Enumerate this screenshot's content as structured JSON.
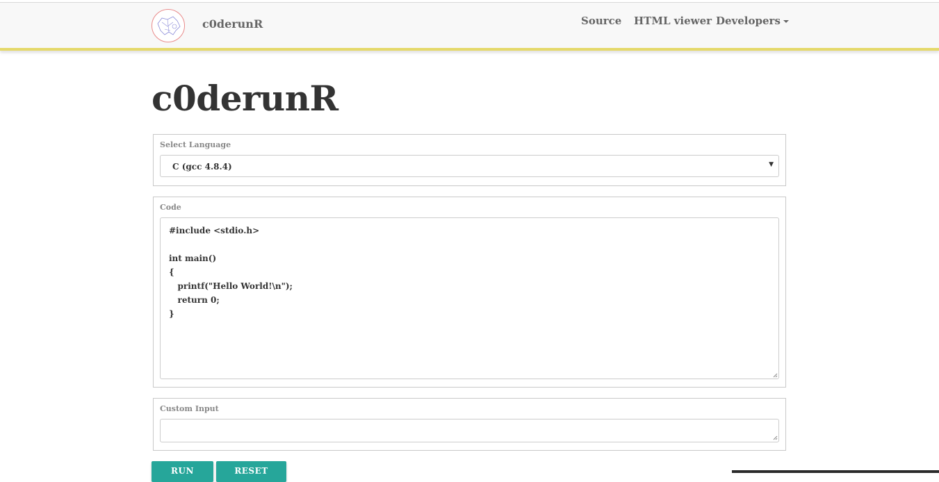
{
  "navbar": {
    "brand": "c0derunR",
    "links": [
      {
        "label": "Source"
      },
      {
        "label": "HTML viewer"
      },
      {
        "label": "Developers"
      }
    ]
  },
  "page": {
    "title": "c0derunR"
  },
  "language": {
    "label": "Select Language",
    "selected": "C (gcc 4.8.4)"
  },
  "code": {
    "label": "Code",
    "value": "#include <stdio.h>\n\nint main()\n{\n   printf(\"Hello World!\\n\");\n   return 0;\n}"
  },
  "custom_input": {
    "label": "Custom Input",
    "value": ""
  },
  "buttons": {
    "run": "RUN",
    "reset": "RESET"
  },
  "colors": {
    "accent": "#26a69a",
    "navbar_border": "#e5d96a"
  }
}
